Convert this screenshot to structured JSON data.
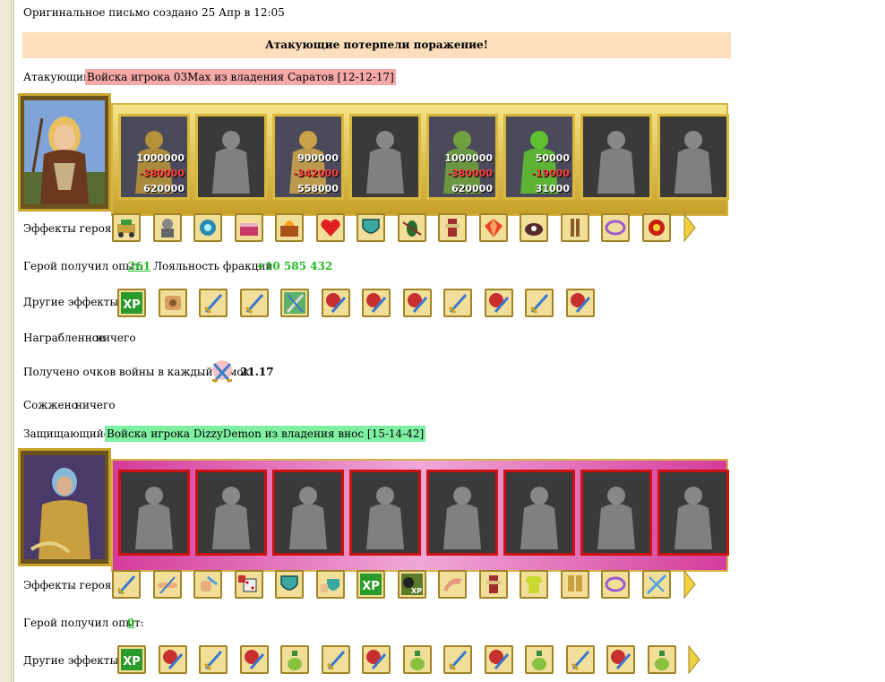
{
  "header": {
    "created": "Оригинальное письмо создано 25 Апр в 12:05"
  },
  "banner": {
    "text": "Атакующие потерпели поражение!"
  },
  "attacker": {
    "label": "Атакующий",
    "name": "Войска игрока 03Max из владения Саратов [12-12-17]",
    "units": [
      {
        "n": "unit-peasant",
        "a": "1000000",
        "l": "-380000",
        "r": "620000",
        "c": "#b5913a"
      },
      {
        "n": "unit-dead",
        "a": "",
        "l": "",
        "r": "",
        "c": "#777"
      },
      {
        "n": "unit-knight",
        "a": "900000",
        "l": "-342000",
        "r": "558000",
        "c": "#c9a24a"
      },
      {
        "n": "unit-dead",
        "a": "",
        "l": "",
        "r": "",
        "c": "#666"
      },
      {
        "n": "unit-archer",
        "a": "1000000",
        "l": "-380000",
        "r": "620000",
        "c": "#6fa040"
      },
      {
        "n": "unit-mage",
        "a": "50000",
        "l": "-19000",
        "r": "31000",
        "c": "#5fc030"
      },
      {
        "n": "unit-dead",
        "a": "",
        "l": "",
        "r": "",
        "c": "#555"
      },
      {
        "n": "unit-dead",
        "a": "",
        "l": "",
        "r": "",
        "c": "#666"
      }
    ],
    "hero_effects_label": "Эффекты героя:",
    "hero_effects": [
      "cart-icon",
      "golem-icon",
      "mechanism-icon",
      "chest-icon",
      "fire-chest-icon",
      "heart-icon",
      "shield-icon",
      "insect-icon",
      "totem-icon",
      "gem-icon",
      "tower-icon",
      "figure-icon",
      "ring-icon",
      "fire-ring-icon"
    ],
    "xp_label": "Герой получил опыт:",
    "xp_value": "261",
    "loyalty_label": "Лояльность фракции",
    "loyalty_value": "+10 585 432",
    "other_effects_label": "Другие эффекты:",
    "other_effects": [
      "xp-icon",
      "scroll-icon",
      "sword-icon",
      "sword-icon",
      "swords-icon",
      "fist-icon",
      "fist-icon",
      "fist-icon",
      "sword-icon",
      "fist-icon",
      "sword-icon",
      "fist-icon"
    ]
  },
  "loot": {
    "label": "Награбленное",
    "value": "ничего"
  },
  "war_points": {
    "label": "Получено очков войны в каждый замок",
    "value": "21.17"
  },
  "burned": {
    "label": "Сожжено",
    "value": "ничего"
  },
  "defender": {
    "label": "Защищающийся",
    "name": "Войска игрока DizzyDemon из владения внос [15-14-42]",
    "hero_effects_label": "Эффекты героя:",
    "hero_effects": [
      "sword-icon",
      "handshake-icon",
      "hand-icon",
      "dice-icon",
      "shield-icon",
      "hand-shield-icon",
      "xp-icon",
      "xp-bug-icon",
      "horn-icon",
      "totem-icon",
      "armor-icon",
      "boots-icon",
      "ring-icon",
      "crossbow-icon"
    ],
    "xp_label": "Герой получил опыт:",
    "xp_value": "0",
    "other_effects_label": "Другие эффекты:",
    "other_effects": [
      "xp-icon",
      "fist-icon",
      "sword-icon",
      "fist-icon",
      "potion-icon",
      "sword-icon",
      "fist-icon",
      "potion-icon",
      "sword-icon",
      "fist-icon",
      "potion-icon",
      "sword-icon",
      "fist-icon",
      "potion-icon"
    ]
  },
  "colors": {
    "banner": "#fcdfbc",
    "attacker_highlight": "#f4a8a8",
    "defender_highlight": "#7ff0a2",
    "xp_green": "#22bb22"
  }
}
